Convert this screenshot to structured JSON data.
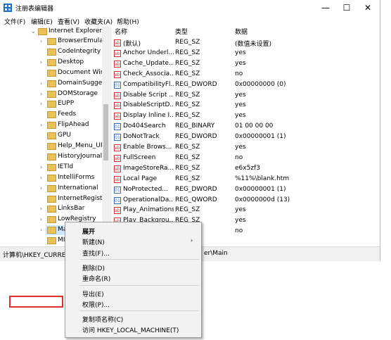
{
  "window": {
    "title": "注册表编辑器",
    "minimize": "—",
    "maximize": "☐",
    "close": "✕"
  },
  "menubar": [
    "文件(F)",
    "编辑(E)",
    "查看(V)",
    "收藏夹(A)",
    "帮助(H)"
  ],
  "tree": {
    "parent": "Internet Explorer",
    "items": [
      {
        "label": "BrowserEmulat",
        "chev": true
      },
      {
        "label": "CodeIntegrity",
        "chev": false
      },
      {
        "label": "Desktop",
        "chev": true
      },
      {
        "label": "Document Win",
        "chev": false
      },
      {
        "label": "DomainSugges",
        "chev": true
      },
      {
        "label": "DOMStorage",
        "chev": true
      },
      {
        "label": "EUPP",
        "chev": true
      },
      {
        "label": "Feeds",
        "chev": false
      },
      {
        "label": "FlipAhead",
        "chev": true
      },
      {
        "label": "GPU",
        "chev": false
      },
      {
        "label": "Help_Menu_UR",
        "chev": false
      },
      {
        "label": "HistoryJournalC",
        "chev": false
      },
      {
        "label": "IETld",
        "chev": true
      },
      {
        "label": "IntelliForms",
        "chev": true
      },
      {
        "label": "International",
        "chev": true
      },
      {
        "label": "InternetRegistr",
        "chev": false
      },
      {
        "label": "LinksBar",
        "chev": true
      },
      {
        "label": "LowRegistry",
        "chev": true
      },
      {
        "label": "Main",
        "chev": true,
        "selected": true
      },
      {
        "label": "MI",
        "chev": false
      }
    ]
  },
  "list": {
    "columns": [
      "名称",
      "类型",
      "数据"
    ],
    "rows": [
      {
        "icon": "ab",
        "name": "(默认)",
        "type": "REG_SZ",
        "data": "(数值未设置)"
      },
      {
        "icon": "ab",
        "name": "Anchor Underl...",
        "type": "REG_SZ",
        "data": "yes"
      },
      {
        "icon": "ab",
        "name": "Cache_Update...",
        "type": "REG_SZ",
        "data": "yes"
      },
      {
        "icon": "ab",
        "name": "Check_Associa...",
        "type": "REG_SZ",
        "data": "no"
      },
      {
        "icon": "bin",
        "name": "CompatibilityFl...",
        "type": "REG_DWORD",
        "data": "0x00000000 (0)"
      },
      {
        "icon": "ab",
        "name": "Disable Script ...",
        "type": "REG_SZ",
        "data": "yes"
      },
      {
        "icon": "ab",
        "name": "DisableScriptD...",
        "type": "REG_SZ",
        "data": "yes"
      },
      {
        "icon": "ab",
        "name": "Display Inline I...",
        "type": "REG_SZ",
        "data": "yes"
      },
      {
        "icon": "bin",
        "name": "Do404Search",
        "type": "REG_BINARY",
        "data": "01 00 00 00"
      },
      {
        "icon": "bin",
        "name": "DoNotTrack",
        "type": "REG_DWORD",
        "data": "0x00000001 (1)"
      },
      {
        "icon": "ab",
        "name": "Enable Brows...",
        "type": "REG_SZ",
        "data": "yes"
      },
      {
        "icon": "ab",
        "name": "FullScreen",
        "type": "REG_SZ",
        "data": "no"
      },
      {
        "icon": "ab",
        "name": "ImageStoreRa...",
        "type": "REG_SZ",
        "data": "e6x5zf3"
      },
      {
        "icon": "ab",
        "name": "Local Page",
        "type": "REG_SZ",
        "data": "%11%\\blank.htm"
      },
      {
        "icon": "bin",
        "name": "NoProtected...",
        "type": "REG_DWORD",
        "data": "0x00000001 (1)"
      },
      {
        "icon": "bin",
        "name": "OperationalDa...",
        "type": "REG_QWORD",
        "data": "0x0000000d (13)"
      },
      {
        "icon": "ab",
        "name": "Play_Animations",
        "type": "REG_SZ",
        "data": "yes"
      },
      {
        "icon": "ab",
        "name": "Play_Backgrou...",
        "type": "REG_SZ",
        "data": "yes"
      },
      {
        "icon": "ab",
        "name": "",
        "type": "",
        "data": "no"
      }
    ]
  },
  "status": {
    "left": "计算机\\HKEY_CURREN",
    "right": "er\\Main"
  },
  "context_menu": {
    "items": [
      {
        "label": "展开",
        "bold": true
      },
      {
        "label": "新建(N)",
        "submenu": true
      },
      {
        "label": "查找(F)..."
      },
      {
        "sep": true
      },
      {
        "label": "删除(D)"
      },
      {
        "label": "重命名(R)"
      },
      {
        "sep": true
      },
      {
        "label": "导出(E)"
      },
      {
        "label": "权限(P)...",
        "highlight": true
      },
      {
        "sep": true
      },
      {
        "label": "复制项名称(C)"
      },
      {
        "label": "访问 HKEY_LOCAL_MACHINE(T)"
      }
    ]
  },
  "colors": {
    "selection": "#cce8ff",
    "highlight_box": "#e0302d",
    "folder": "#e8c15a"
  }
}
